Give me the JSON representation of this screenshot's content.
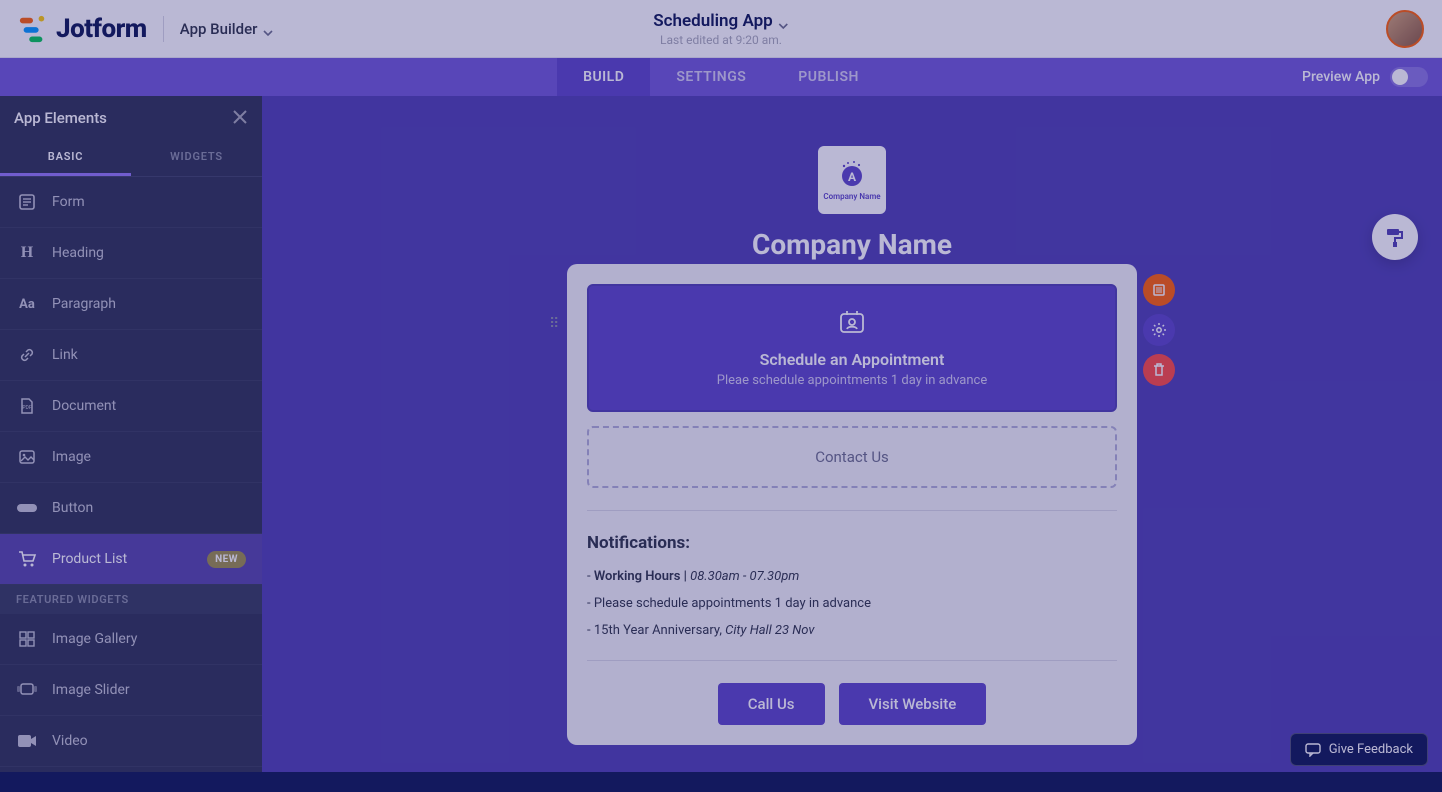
{
  "header": {
    "brand": "Jotform",
    "app_builder_label": "App Builder",
    "title": "Scheduling App",
    "subtitle": "Last edited at 9:20 am."
  },
  "tabs": {
    "build": "BUILD",
    "settings": "SETTINGS",
    "publish": "PUBLISH",
    "preview_label": "Preview App"
  },
  "sidebar": {
    "title": "App Elements",
    "tab_basic": "BASIC",
    "tab_widgets": "WIDGETS",
    "items": [
      {
        "label": "Form",
        "icon": "form"
      },
      {
        "label": "Heading",
        "icon": "heading"
      },
      {
        "label": "Paragraph",
        "icon": "paragraph"
      },
      {
        "label": "Link",
        "icon": "link"
      },
      {
        "label": "Document",
        "icon": "document"
      },
      {
        "label": "Image",
        "icon": "image"
      },
      {
        "label": "Button",
        "icon": "button"
      },
      {
        "label": "Product List",
        "icon": "cart",
        "badge": "NEW",
        "selected": true
      }
    ],
    "featured_section": "FEATURED WIDGETS",
    "featured": [
      {
        "label": "Image Gallery",
        "icon": "gallery"
      },
      {
        "label": "Image Slider",
        "icon": "slider"
      },
      {
        "label": "Video",
        "icon": "video"
      }
    ]
  },
  "canvas": {
    "company_logo_text": "Company Name",
    "company_name": "Company Name",
    "schedule": {
      "title": "Schedule an Appointment",
      "subtitle": "Pleae schedule appointments 1 day in advance"
    },
    "contact_label": "Contact Us",
    "notifications_title": "Notifications:",
    "notifications": [
      {
        "prefix": "- ",
        "bold": "Working Hours | ",
        "italic": "08.30am - 07.30pm"
      },
      {
        "prefix": "- ",
        "text": "Please schedule appointments 1 day in advance"
      },
      {
        "prefix": "- ",
        "text": "15th Year Anniversary, ",
        "italic": "City Hall 23 Nov"
      }
    ],
    "cta": {
      "call": "Call Us",
      "visit": "Visit Website"
    }
  },
  "feedback_label": "Give Feedback"
}
